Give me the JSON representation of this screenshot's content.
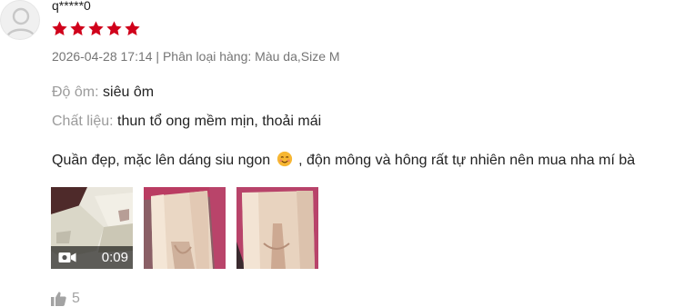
{
  "review": {
    "username": "q*****0",
    "rating": 5,
    "star_color": "#d0011b",
    "timestamp": "2026-04-28 17:14",
    "separator": " | ",
    "variation_label": "Phân loại hàng:",
    "variation_value": "Màu da,Size M",
    "attributes": [
      {
        "label": "Độ ôm:",
        "value": "siêu ôm"
      },
      {
        "label": "Chất liệu:",
        "value": "thun tổ ong mềm mịn, thoải mái"
      }
    ],
    "comment_before": "Quần đẹp, mặc lên dáng siu ngon",
    "comment_emoji": "smiling-face-emoji",
    "comment_after": " , độn mông và hông rất tự nhiên nên mua nha mí bà",
    "media": [
      {
        "type": "video",
        "duration": "0:09",
        "icon": "video-camera-icon"
      },
      {
        "type": "image"
      },
      {
        "type": "image"
      }
    ],
    "likes": "5",
    "like_icon": "thumbs-up-icon"
  }
}
